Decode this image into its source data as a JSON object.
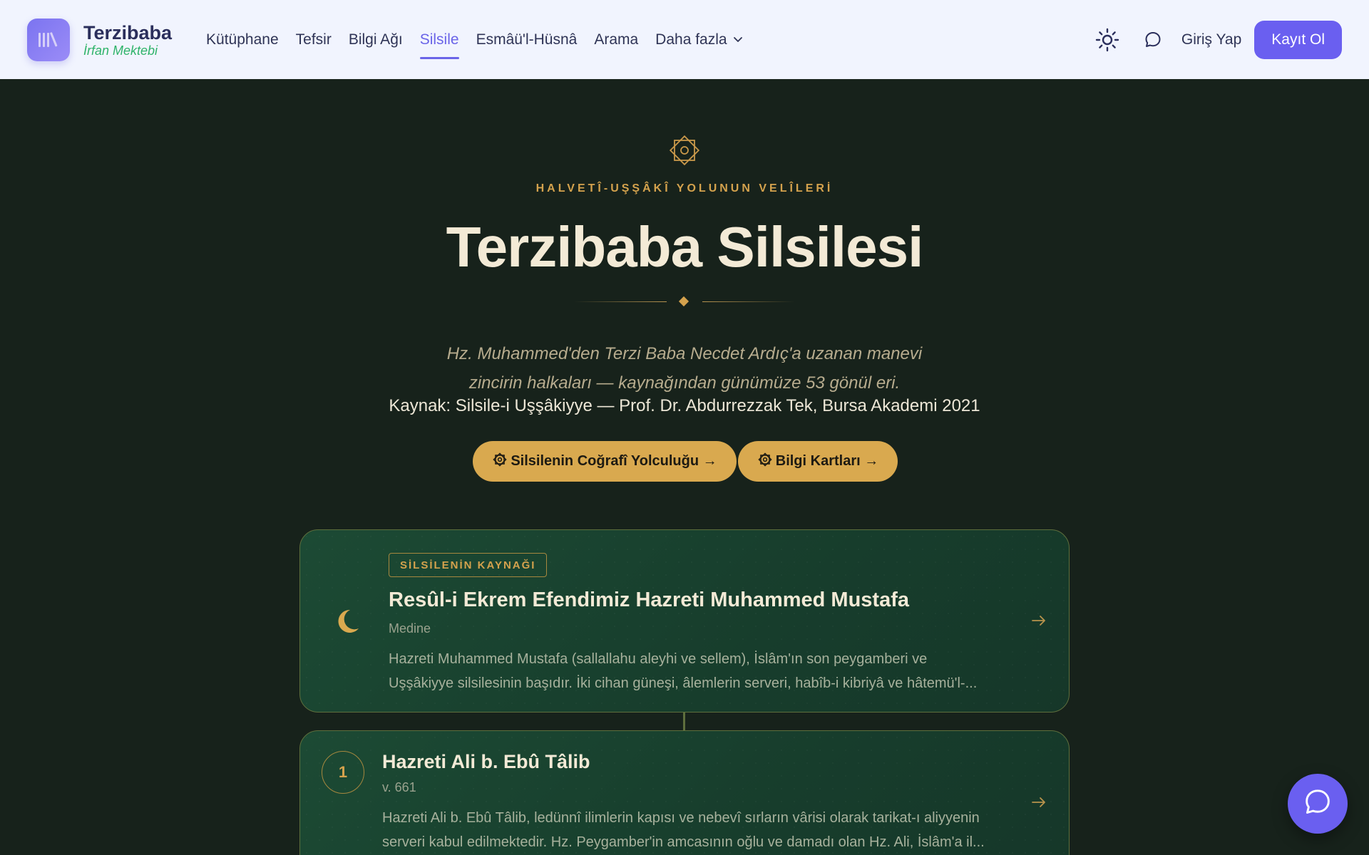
{
  "brand": {
    "title": "Terzibaba",
    "subtitle": "İrfan Mektebi"
  },
  "nav": {
    "items": [
      {
        "label": "Kütüphane",
        "active": false
      },
      {
        "label": "Tefsir",
        "active": false
      },
      {
        "label": "Bilgi Ağı",
        "active": false
      },
      {
        "label": "Silsile",
        "active": true
      },
      {
        "label": "Esmâü'l-Hüsnâ",
        "active": false
      },
      {
        "label": "Arama",
        "active": false
      }
    ],
    "more_label": "Daha fazla"
  },
  "header": {
    "login_label": "Giriş Yap",
    "signup_label": "Kayıt Ol"
  },
  "hero": {
    "overline": "HALVETÎ-UŞŞÂKÎ YOLUNUN VELÎLERİ",
    "title": "Terzibaba Silsilesi",
    "lead_line1": "Hz. Muhammed'den Terzi Baba Necdet Ardıç'a uzanan manevi",
    "lead_line2": "zincirin halkaları — kaynağından günümüze 53 gönül eri.",
    "source": "Kaynak: Silsile-i Uşşâkiyye — Prof. Dr. Abdurrezzak Tek, Bursa Akademi 2021",
    "cta_journey": "Silsilenin Coğrafî Yolculuğu →",
    "cta_cards": "Bilgi Kartları →"
  },
  "cards": [
    {
      "badge": "SİLSİLENİN KAYNAĞI",
      "title": "Resûl-i Ekrem Efendimiz Hazreti Muhammed Mustafa",
      "meta": "Medine",
      "description": "Hazreti Muhammed Mustafa (sallallahu aleyhi ve sellem), İslâm'ın son peygamberi ve\nUşşâkiyye silsilesinin başıdır. İki cihan güneşi, âlemlerin serveri, habîb-i kibriyâ ve hâtemü'l-..."
    },
    {
      "number": "1",
      "title": "Hazreti Ali b. Ebû Tâlib",
      "meta": "v. 661",
      "description": "Hazreti Ali b. Ebû Tâlib, ledünnî ilimlerin kapısı ve nebevî sırların vârisi olarak tarikat-ı aliyyenin\nserveri kabul edilmektedir. Hz. Peygamber'in amcasının oğlu ve damadı olan Hz. Ali, İslâm'a il..."
    }
  ],
  "colors": {
    "accent": "#6a5ff0",
    "gold": "#d4a24d",
    "background": "#17221b",
    "header_bg": "#f1f4fe"
  },
  "icons": {
    "logo": "library-books-icon",
    "theme": "sun-icon",
    "chat": "chat-bubble-icon"
  }
}
